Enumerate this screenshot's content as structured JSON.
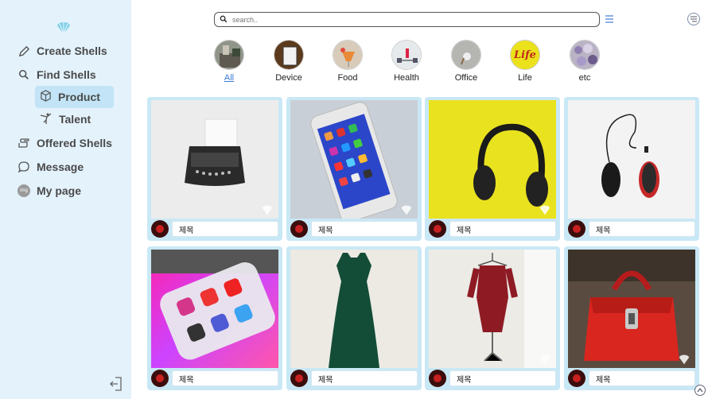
{
  "sidebar": {
    "items": [
      {
        "label": "Create Shells",
        "icon": "pencil-icon"
      },
      {
        "label": "Find Shells",
        "icon": "search-icon"
      },
      {
        "label": "Product",
        "icon": "box-icon"
      },
      {
        "label": "Talent",
        "icon": "dancer-icon"
      },
      {
        "label": "Offered Shells",
        "icon": "hand-icon"
      },
      {
        "label": "Message",
        "icon": "chat-bubble-icon"
      },
      {
        "label": "My page",
        "icon": "avatar-icon"
      }
    ],
    "avatar_text": "img"
  },
  "search": {
    "placeholder": "search.."
  },
  "categories": [
    {
      "label": "All"
    },
    {
      "label": "Device"
    },
    {
      "label": "Food"
    },
    {
      "label": "Health"
    },
    {
      "label": "Office"
    },
    {
      "label": "Life"
    },
    {
      "label": "etc"
    }
  ],
  "life_logo_text": "Life",
  "cards": [
    {
      "title": "제목",
      "image": "typewriter"
    },
    {
      "title": "제목",
      "image": "smartphone"
    },
    {
      "title": "제목",
      "image": "headphones"
    },
    {
      "title": "제목",
      "image": "computer-mice"
    },
    {
      "title": "제목",
      "image": "social-apps-phone"
    },
    {
      "title": "제목",
      "image": "green-dress"
    },
    {
      "title": "제목",
      "image": "red-dress"
    },
    {
      "title": "제목",
      "image": "red-handbag"
    }
  ],
  "colors": {
    "sidebar_bg": "#e3f2fb",
    "active_bg": "#c2e4f6",
    "card_bg": "#c9e8f6",
    "accent": "#3a7bd5"
  }
}
